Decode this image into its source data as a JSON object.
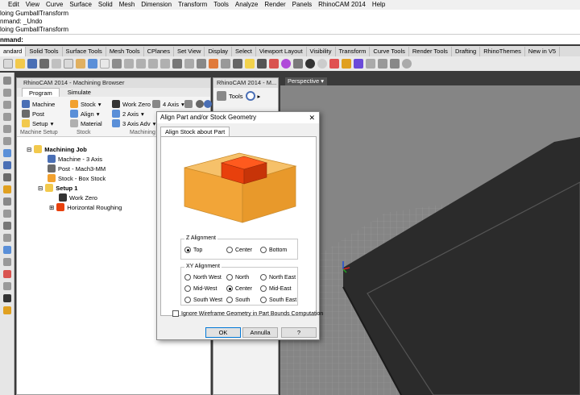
{
  "menu": [
    "Edit",
    "View",
    "Curve",
    "Surface",
    "Solid",
    "Mesh",
    "Dimension",
    "Transform",
    "Tools",
    "Analyze",
    "Render",
    "Panels",
    "RhinoCAM 2014",
    "Help"
  ],
  "history": [
    "loing GumballTransform",
    "nmand: _Undo",
    "loing GumballTransform"
  ],
  "command_prompt": "nmand:",
  "toolbar_tabs": [
    "andard",
    "Solid Tools",
    "Surface Tools",
    "Mesh Tools",
    "CPlanes",
    "Set View",
    "Display",
    "Select",
    "Viewport Layout",
    "Visibility",
    "Transform",
    "Curve Tools",
    "Render Tools",
    "Drafting",
    "RhinoThemes",
    "New in V5"
  ],
  "toolbar_active_tab": "andard",
  "colors": {
    "accent_orange": "#f2a12e",
    "part_red": "#e8400c",
    "dialog_bg": "#f0f0f0",
    "viewport_bg": "#858585",
    "model_dark": "#2b2b2b"
  },
  "browser": {
    "title": "RhinoCAM 2014 - Machining Browser",
    "tabs": [
      "Program",
      "Simulate"
    ],
    "ribbon": {
      "machine": "Machine",
      "post": "Post",
      "setup": "Setup",
      "stock": "Stock",
      "align": "Align",
      "material": "Material",
      "work_zero": "Work Zero",
      "axis2": "2 Axis",
      "axis3_adv": "3 Axis Adv",
      "axis4": "4 Axis",
      "group_setup": "Machine Setup",
      "group_stock": "Stock",
      "group_ops": "Machining O"
    },
    "tree": {
      "root": "Machining Job",
      "machine": "Machine - 3 Axis",
      "post": "Post - Mach3-MM",
      "stock": "Stock - Box Stock",
      "setup": "Setup 1",
      "work_zero": "Work Zero",
      "roughing": "Horizontal Roughing"
    }
  },
  "panel2": {
    "title": "RhinoCAM 2014 - M...",
    "tools_label": "Tools"
  },
  "viewport": {
    "label": "Perspective"
  },
  "dialog": {
    "title": "Align Part and/or Stock Geometry",
    "tab": "Align Stock about Part",
    "z_alignment": {
      "label": "Z Alignment",
      "options": [
        "Top",
        "Center",
        "Bottom"
      ],
      "selected": "Top"
    },
    "xy_alignment": {
      "label": "XY Alignment",
      "options": [
        "North West",
        "North",
        "North East",
        "Mid-West",
        "Center",
        "Mid-East",
        "South West",
        "South",
        "South East"
      ],
      "selected": "Center"
    },
    "ignore_wireframe": {
      "label": "Ignore Wireframe Geometry in Part Bounds Computation",
      "checked": false
    },
    "buttons": {
      "ok": "OK",
      "cancel": "Annulla",
      "help": "?"
    }
  }
}
